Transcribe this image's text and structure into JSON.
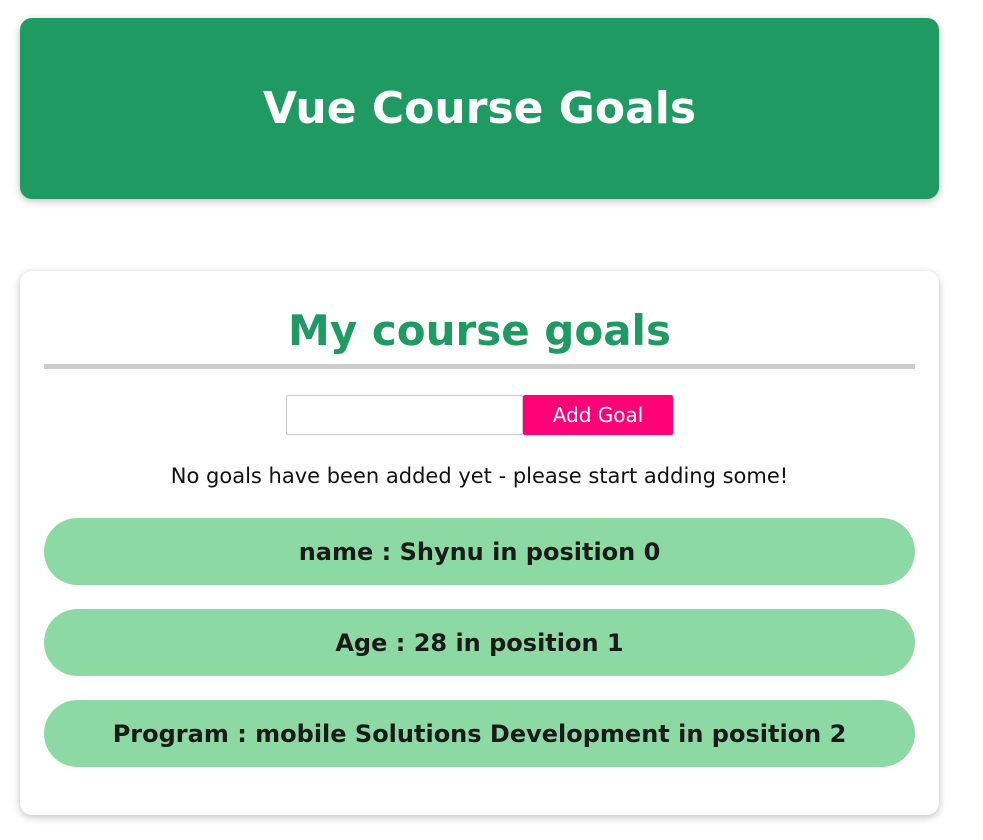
{
  "header": {
    "title": "Vue Course Goals"
  },
  "card": {
    "title": "My course goals",
    "input": {
      "value": "",
      "placeholder": ""
    },
    "add_button_label": "Add Goal",
    "empty_message": "No goals have been added yet - please start adding some!",
    "goals": [
      "name : Shynu in position 0",
      "Age : 28 in position 1",
      "Program : mobile Solutions Development in position 2"
    ]
  },
  "colors": {
    "brand_green": "#1e9a62",
    "goal_item_bg": "#8cd9a4",
    "add_button_bg": "#ff0077",
    "rule_gray": "#cccccc"
  }
}
